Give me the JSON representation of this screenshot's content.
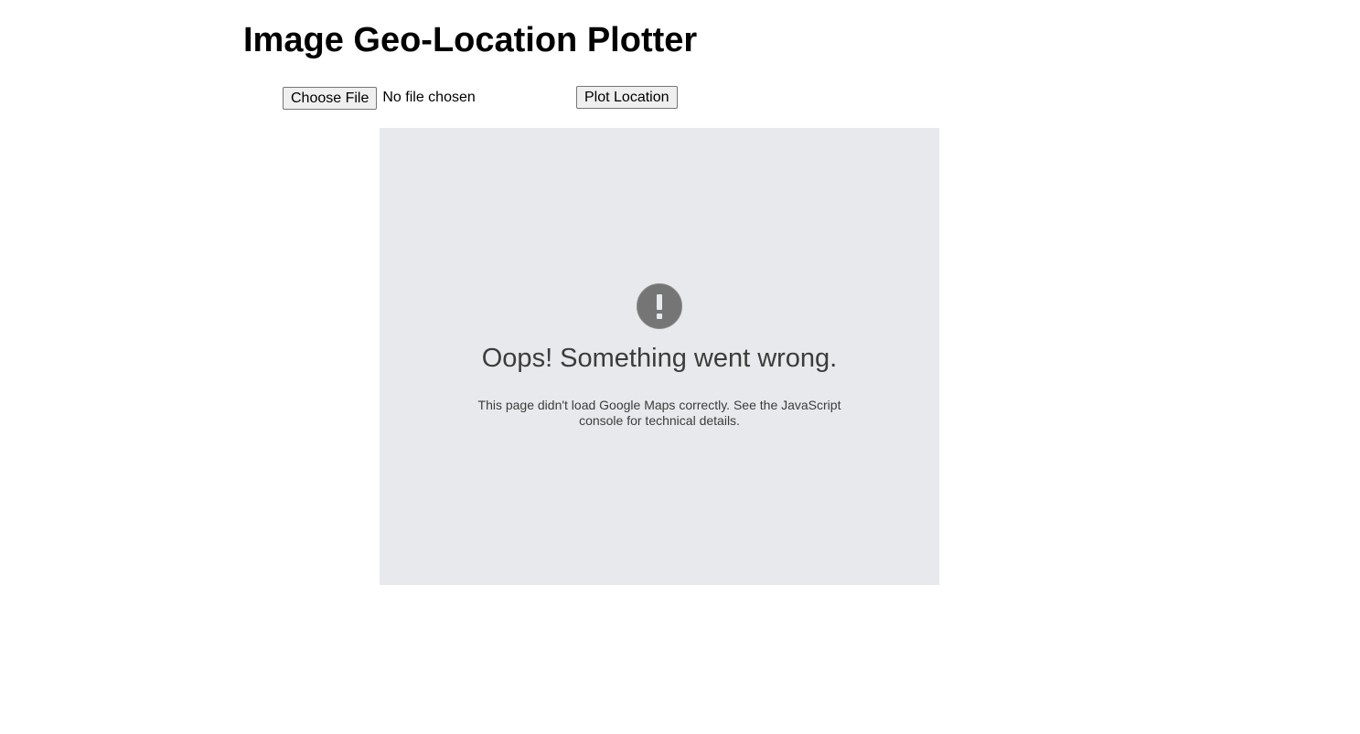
{
  "header": {
    "title": "Image Geo-Location Plotter"
  },
  "upload": {
    "choose_file_label": "Choose File",
    "file_status": "No file chosen",
    "plot_button_label": "Plot Location"
  },
  "map": {
    "background_color": "#e8e9ec",
    "icon": "exclamation-circle-icon",
    "error_title": "Oops! Something went wrong.",
    "error_message": "This page didn't load Google Maps correctly. See the JavaScript console for technical details."
  }
}
